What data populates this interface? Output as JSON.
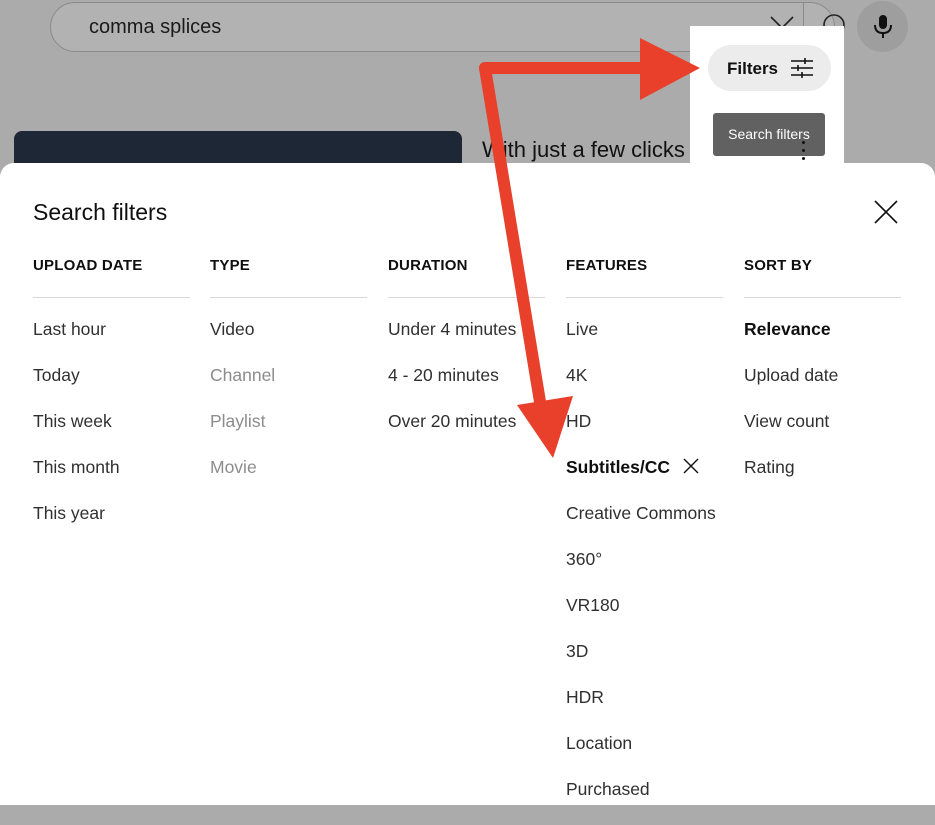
{
  "search": {
    "query": "comma splices"
  },
  "video": {
    "title": "With just a few clicks ps, gram"
  },
  "filters_button": {
    "label": "Filters"
  },
  "tooltip": {
    "text": "Search filters"
  },
  "dialog": {
    "title": "Search filters",
    "columns": [
      {
        "header": "UPLOAD DATE",
        "items": [
          "Last hour",
          "Today",
          "This week",
          "This month",
          "This year"
        ]
      },
      {
        "header": "TYPE",
        "items": [
          "Video",
          "Channel",
          "Playlist",
          "Movie"
        ]
      },
      {
        "header": "DURATION",
        "items": [
          "Under 4 minutes",
          "4 - 20 minutes",
          "Over 20 minutes"
        ]
      },
      {
        "header": "FEATURES",
        "items": [
          "Live",
          "4K",
          "HD",
          "Subtitles/CC",
          "Creative Commons",
          "360°",
          "VR180",
          "3D",
          "HDR",
          "Location",
          "Purchased"
        ]
      },
      {
        "header": "SORT BY",
        "items": [
          "Relevance",
          "Upload date",
          "View count",
          "Rating"
        ]
      }
    ]
  },
  "colors": {
    "annotation_arrow": "#e8402a",
    "overlay": "#ababab",
    "tooltip_bg": "#616161"
  }
}
